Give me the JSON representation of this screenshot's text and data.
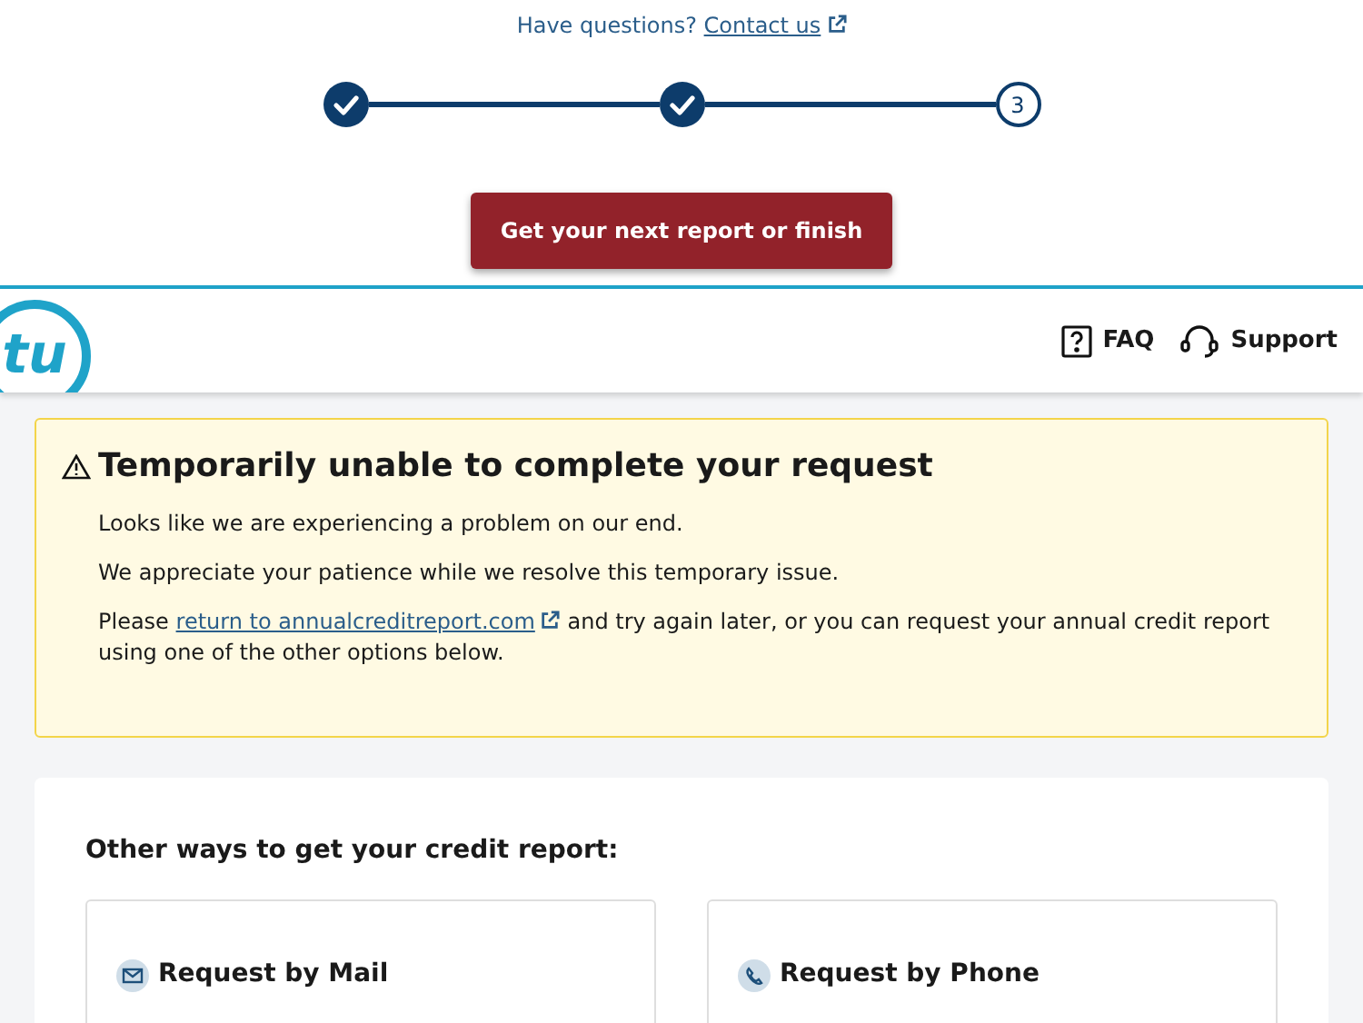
{
  "help": {
    "prompt": "Have questions?",
    "link": "Contact us"
  },
  "steps": [
    {
      "kind": "done"
    },
    {
      "kind": "done"
    },
    {
      "kind": "number",
      "label": "3"
    }
  ],
  "primary_button": "Get your next report or finish",
  "header": {
    "logo": "tu",
    "links": [
      {
        "kind": "faq",
        "label": "FAQ"
      },
      {
        "kind": "support",
        "label": "Support"
      }
    ]
  },
  "alert": {
    "title": "Temporarily unable to complete your request",
    "lines": [
      "Looks like we are experiencing a problem on our end.",
      "We appreciate your patience while we resolve this temporary issue."
    ],
    "last": {
      "before": "Please",
      "link": "return to annualcreditreport.com",
      "after": "and try again later, or you can request your annual credit report using one of the other options below."
    }
  },
  "options": {
    "title": "Other ways to get your credit report:",
    "items": [
      {
        "kind": "mail",
        "label": "Request by Mail"
      },
      {
        "kind": "phone",
        "label": "Request by Phone"
      }
    ]
  }
}
